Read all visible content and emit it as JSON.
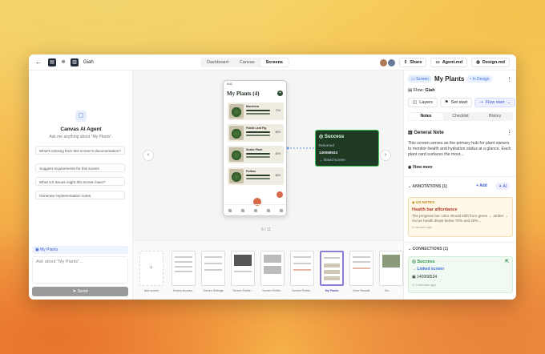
{
  "topbar": {
    "project": "Giah",
    "tabs": [
      "Dashboard",
      "Canvas",
      "Screens"
    ],
    "active_tab": "Screens",
    "share": "Share",
    "agent_md": "Agent.md",
    "design_md": "Design.md"
  },
  "agent": {
    "title": "Canvas AI Agent",
    "subtitle": "Ask me anything about \"My Plants\".",
    "suggestions": [
      "What's missing from this screen's documentation?",
      "Suggest requirements for this screen",
      "What UX issues might this screen have?",
      "Generate implementation notes"
    ],
    "context": "My Plants",
    "placeholder": "Ask about \"My Plants\"...",
    "send": "Send"
  },
  "canvas": {
    "phone": {
      "status": "9:41",
      "title": "My Plants (4)",
      "plants": [
        {
          "name": "Monstera",
          "pct": "72%"
        },
        {
          "name": "Fiddle Leaf Fig",
          "pct": "58%"
        },
        {
          "name": "Snake Plant",
          "pct": "84%"
        },
        {
          "name": "Pothos",
          "pct": "66%"
        }
      ]
    },
    "success": {
      "title": "Success",
      "r1": "Returned",
      "r2": "140068534",
      "r3": "→ linked screen"
    },
    "page": "6 / 11"
  },
  "strip": {
    "items": [
      "Add screen",
      "Screen Access...",
      "Screen Settings",
      "Screen Profile...",
      "Screen Profile...",
      "Screen Profile...",
      "My Plants",
      "Error Results",
      "Scr..."
    ]
  },
  "panel": {
    "screen_tag": "Screen",
    "title": "My Plants",
    "status": "In Design",
    "flow_label": "Flow:",
    "flow": "Giah",
    "layers": "Layers",
    "set_start": "Set start",
    "flow_start": "Flow start",
    "tabs": [
      "Notes",
      "Checklist",
      "History"
    ],
    "note_title": "General Note",
    "note_text": "This screen serves as the primary hub for plant owners to monitor health and hydration status at a glance. Each plant card surfaces the most...",
    "view_more": "View more",
    "annotations_label": "ANNOTATIONS (1)",
    "add": "+ Add",
    "ai": "AI",
    "ux_tag": "UX NOTES",
    "ann_title": "Health bar affordance",
    "ann_text": "The progress bar color should shift from green → amber → red as health drops below 70% and 40%...",
    "ann_time": "5 minutes ago",
    "connections_label": "CONNECTIONS (1)",
    "conn_title": "Success",
    "conn_link": "Linked screen",
    "conn_id": "140068534",
    "conn_time": "5 minutes ago"
  }
}
